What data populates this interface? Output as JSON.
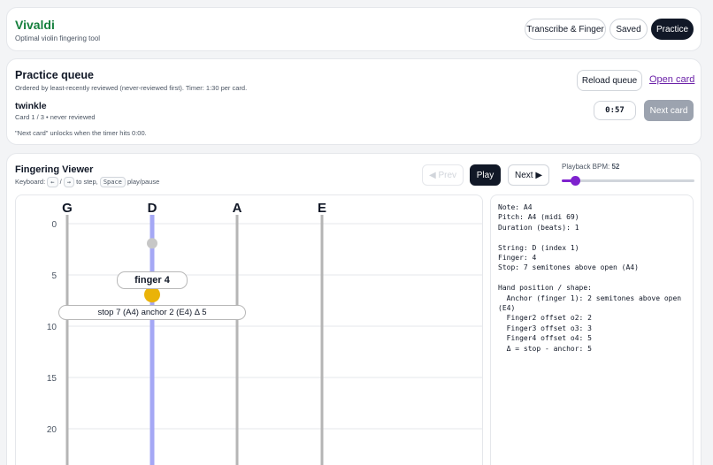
{
  "header": {
    "brand": "Vivaldi",
    "tagline": "Optimal violin fingering tool",
    "nav": [
      "Transcribe & Finger",
      "Saved",
      "Practice"
    ],
    "active_nav": "Practice"
  },
  "queue": {
    "title": "Practice queue",
    "subtitle": "Ordered by least-recently reviewed (never-reviewed first). Timer: 1:30 per card.",
    "reload_label": "Reload queue",
    "open_card_label": "Open card",
    "card_title": "twinkle",
    "card_meta": "Card 1 / 3 • never reviewed",
    "timer": "0:57",
    "next_card_label": "Next card",
    "note": "\"Next card\" unlocks when the timer hits 0:00."
  },
  "viewer": {
    "title": "Fingering Viewer",
    "kb_prefix": "Keyboard:",
    "kb_left": "←",
    "kb_sep": "/",
    "kb_right": "→",
    "kb_mid": "to step,",
    "kb_space": "Space",
    "kb_suffix": "play/pause",
    "prev_label": "◀ Prev",
    "play_label": "Play",
    "next_label": "Next ▶",
    "bpm_label": "Playback BPM:",
    "bpm_value": "52",
    "bpm_level": 0.1,
    "strings": [
      "G",
      "D",
      "A",
      "E"
    ],
    "active_string": "D",
    "y_ticks": [
      "0",
      "5",
      "10",
      "15",
      "20"
    ],
    "active_stop": 7,
    "ghost_stop": 2,
    "finger_label": "finger 4",
    "stop_label": "stop 7 (A4) anchor 2 (E4) Δ 5",
    "info_text": "Note: A4\nPitch: A4 (midi 69)\nDuration (beats): 1\n\nString: D (index 1)\nFinger: 4\nStop: 7 semitones above open (A4)\n\nHand position / shape:\n  Anchor (finger 1): 2 semitones above open (E4)\n  Finger2 offset o2: 2\n  Finger3 offset o3: 3\n  Finger4 offset o4: 5\n  Δ = stop - anchor: 5"
  },
  "colors": {
    "brand": "#15803d",
    "active_string": "#a5a8f5",
    "finger_dot": "#eab308",
    "ghost_dot": "#c7c7c7",
    "slider": "#7e22ce"
  }
}
